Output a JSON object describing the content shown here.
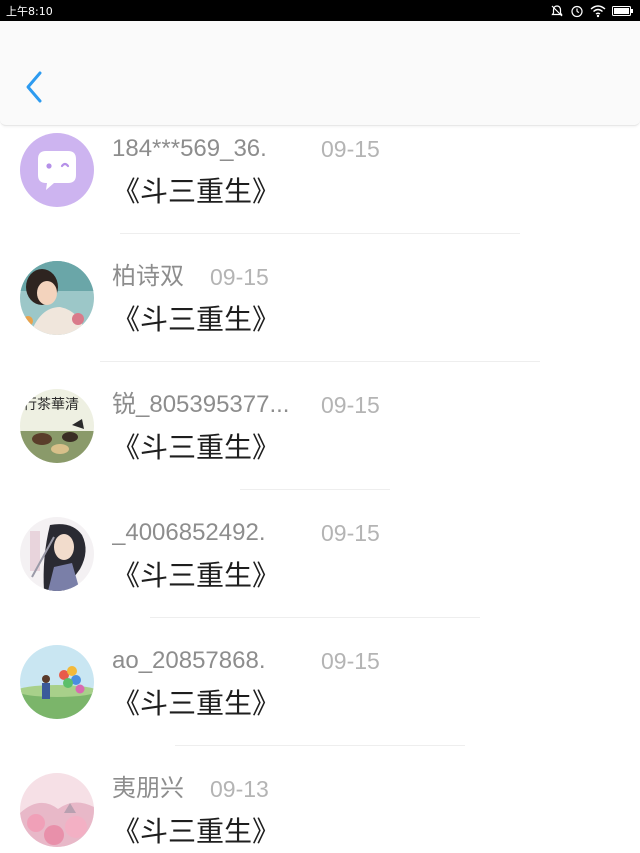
{
  "status_bar": {
    "time": "上午8:10",
    "icons": [
      "mute-bell-icon",
      "alarm-icon",
      "wifi-icon",
      "battery-icon"
    ]
  },
  "header": {
    "back_icon": "chevron-left-icon",
    "accent": "#2d9bf0"
  },
  "rows": [
    {
      "name": "184***569_36.",
      "date": "09-15",
      "message": "《斗三重生》",
      "avatar": "chat-bubble-face"
    },
    {
      "name": "柏诗双",
      "date": "09-15",
      "message": "《斗三重生》",
      "avatar": "girl-photo"
    },
    {
      "name": "锐_805395377...",
      "date": "09-15",
      "message": "《斗三重生》",
      "avatar": "tea-painting"
    },
    {
      "name": "_4006852492.",
      "date": "09-15",
      "message": "《斗三重生》",
      "avatar": "anime-swordsman"
    },
    {
      "name": "ao_20857868.",
      "date": "09-15",
      "message": "《斗三重生》",
      "avatar": "balloon-girl"
    },
    {
      "name": "夷朋兴",
      "date": "09-13",
      "message": "《斗三重生》",
      "avatar": "pink-landscape"
    }
  ]
}
